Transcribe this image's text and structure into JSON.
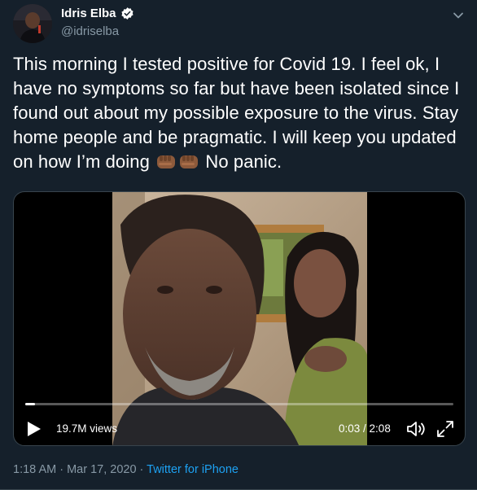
{
  "colors": {
    "background": "#15202b",
    "text": "#ffffff",
    "secondary_text": "#8899a6",
    "link": "#1da1f2",
    "verified_badge": "#ffffff"
  },
  "author": {
    "display_name": "Idris Elba",
    "handle": "@idriselba",
    "verified": true
  },
  "tweet": {
    "text_part1": "This morning I tested positive for Covid 19. I feel ok, I have no symptoms so far but have been isolated since I found out about my possible exposure to the virus.  Stay home people and be pragmatic. I will keep you updated on how I’m doing",
    "emoji_icons": [
      "fist-medium-dark-skin-icon",
      "fist-medium-dark-skin-icon"
    ],
    "text_part2": "No panic."
  },
  "video": {
    "views": "19.7M views",
    "current_time": "0:03",
    "separator": " / ",
    "duration": "2:08",
    "progress_fraction": 0.023,
    "icons": {
      "play": "play-icon",
      "volume": "volume-icon",
      "fullscreen": "fullscreen-icon"
    }
  },
  "meta": {
    "timestamp": "1:18 AM · Mar 17, 2020",
    "dot": " · ",
    "source": "Twitter for iPhone"
  }
}
